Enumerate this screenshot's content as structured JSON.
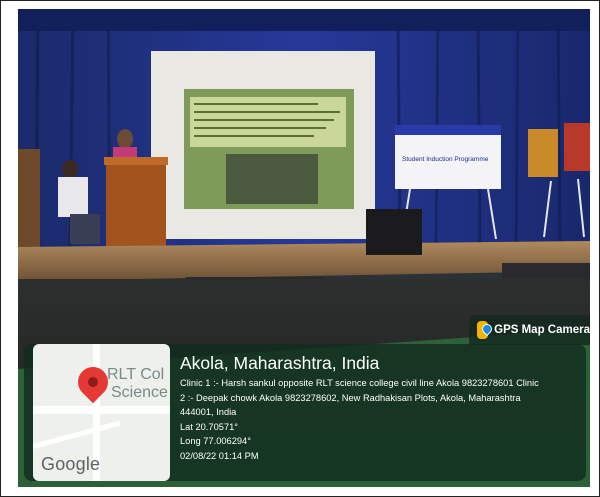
{
  "overlay": {
    "app_name": "GPS Map Camera",
    "location_title": "Akola, Maharashtra, India",
    "address_lines": [
      "Clinic 1 :- Harsh sankul opposite RLT science college civil line Akola 9823278601 Clinic",
      "2 :- Deepak chowk Akola 9823278602, New Radhakisan Plots, Akola, Maharashtra",
      "444001, India"
    ],
    "latitude": "Lat 20.70571°",
    "longitude": "Long 77.006294°",
    "datetime": "02/08/22 01:14 PM"
  },
  "map": {
    "place_label_1": "RLT Col",
    "place_label_2": "Science",
    "provider": "Google",
    "pin_color": "#e53935"
  },
  "banner": {
    "line1": "Student Induction Programme"
  },
  "colors": {
    "stamp_bg": "#102c1e",
    "curtain": "#1c2f7a",
    "stage": "#8a6a4a"
  }
}
